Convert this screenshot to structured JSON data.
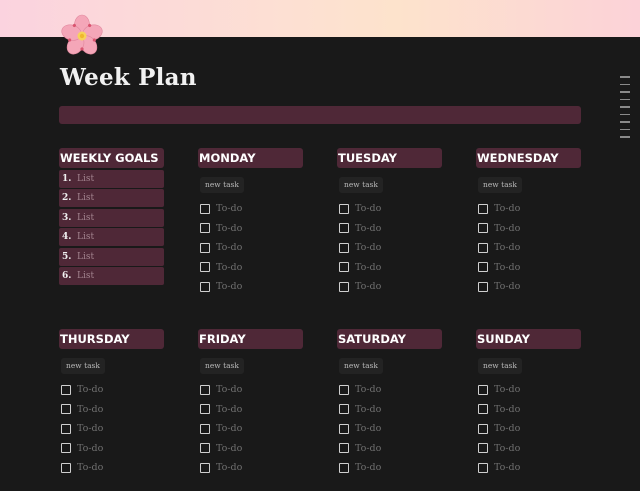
{
  "page": {
    "title": "Week Plan",
    "icon": "cherry-blossom-icon",
    "cover_colors": [
      "#fbd3df",
      "#fde3cc",
      "#fcd2d8"
    ]
  },
  "colors": {
    "accent": "#4f2837",
    "background": "#191919"
  },
  "weekly_goals": {
    "header": "WEEKLY GOALS",
    "items": [
      {
        "num": "1.",
        "text": "List"
      },
      {
        "num": "2.",
        "text": "List"
      },
      {
        "num": "3.",
        "text": "List"
      },
      {
        "num": "4.",
        "text": "List"
      },
      {
        "num": "5.",
        "text": "List"
      },
      {
        "num": "6.",
        "text": "List"
      }
    ]
  },
  "days": [
    {
      "name": "MONDAY",
      "new_task": "new task",
      "todos": [
        "To-do",
        "To-do",
        "To-do",
        "To-do",
        "To-do"
      ]
    },
    {
      "name": "TUESDAY",
      "new_task": "new task",
      "todos": [
        "To-do",
        "To-do",
        "To-do",
        "To-do",
        "To-do"
      ]
    },
    {
      "name": "WEDNESDAY",
      "new_task": "new task",
      "todos": [
        "To-do",
        "To-do",
        "To-do",
        "To-do",
        "To-do"
      ]
    },
    {
      "name": "THURSDAY",
      "new_task": "new task",
      "todos": [
        "To-do",
        "To-do",
        "To-do",
        "To-do",
        "To-do"
      ]
    },
    {
      "name": "FRIDAY",
      "new_task": "new task",
      "todos": [
        "To-do",
        "To-do",
        "To-do",
        "To-do",
        "To-do"
      ]
    },
    {
      "name": "SATURDAY",
      "new_task": "new task",
      "todos": [
        "To-do",
        "To-do",
        "To-do",
        "To-do",
        "To-do"
      ]
    },
    {
      "name": "SUNDAY",
      "new_task": "new task",
      "todos": [
        "To-do",
        "To-do",
        "To-do",
        "To-do",
        "To-do"
      ]
    }
  ]
}
